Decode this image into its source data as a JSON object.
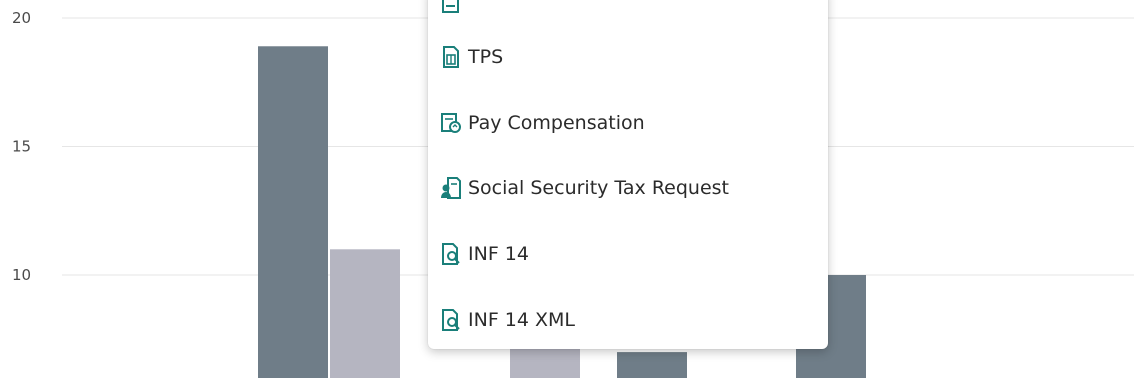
{
  "chart_data": {
    "type": "bar",
    "y_ticks": [
      "10",
      "15",
      "20"
    ],
    "series": [
      {
        "values": [
          18.9,
          null,
          6.8,
          null,
          null
        ],
        "color": "#6f7d88"
      },
      {
        "values": [
          11.0,
          null,
          8.0,
          null,
          null
        ],
        "color": "#b5b5c1"
      },
      {
        "values": [
          null,
          null,
          null,
          null,
          10.0
        ],
        "color": "#6f7d88"
      }
    ],
    "visible_bars": [
      {
        "series": 0,
        "value": 18.9
      },
      {
        "series": 1,
        "value": 11.0
      },
      {
        "series": 1,
        "value": 8.0
      },
      {
        "series": 0,
        "value": 7.0
      },
      {
        "series": 0,
        "value": 10.0
      }
    ],
    "ylim": [
      6.0,
      20.5
    ],
    "grid": true
  },
  "menu": {
    "items": [
      {
        "label": "",
        "icon": "report-icon"
      },
      {
        "label": "TPS",
        "icon": "calculator-report-icon"
      },
      {
        "label": "Pay Compensation",
        "icon": "compensation-icon"
      },
      {
        "label": "Social Security Tax Request",
        "icon": "tax-request-icon"
      },
      {
        "label": "INF 14",
        "icon": "report-search-icon"
      },
      {
        "label": "INF 14 XML",
        "icon": "report-search-icon"
      }
    ]
  },
  "colors": {
    "icon_teal": "#1a7f7a",
    "bar_dark": "#6f7d88",
    "bar_light": "#b5b5c1"
  }
}
